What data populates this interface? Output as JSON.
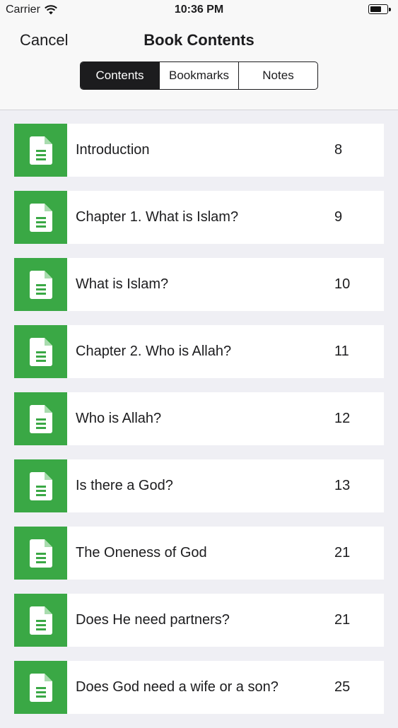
{
  "status_bar": {
    "carrier": "Carrier",
    "time": "10:36 PM"
  },
  "nav": {
    "cancel_label": "Cancel",
    "title": "Book Contents"
  },
  "tabs": [
    {
      "label": "Contents",
      "active": true
    },
    {
      "label": "Bookmarks",
      "active": false
    },
    {
      "label": "Notes",
      "active": false
    }
  ],
  "contents": [
    {
      "title": "Introduction",
      "page": "8"
    },
    {
      "title": "Chapter 1. What is Islam?",
      "page": "9"
    },
    {
      "title": "What is Islam?",
      "page": "10"
    },
    {
      "title": "Chapter 2. Who is Allah?",
      "page": "11"
    },
    {
      "title": "Who is Allah?",
      "page": "12"
    },
    {
      "title": "Is there a God?",
      "page": "13"
    },
    {
      "title": "The Oneness of God",
      "page": "21"
    },
    {
      "title": "Does He need partners?",
      "page": "21"
    },
    {
      "title": "Does God need a wife or a son?",
      "page": "25"
    }
  ],
  "colors": {
    "accent": "#3aa845",
    "background": "#efeff4",
    "text": "#1c1c1e"
  },
  "icons": {
    "row_icon": "document-icon",
    "wifi": "wifi-icon",
    "battery": "battery-icon"
  }
}
